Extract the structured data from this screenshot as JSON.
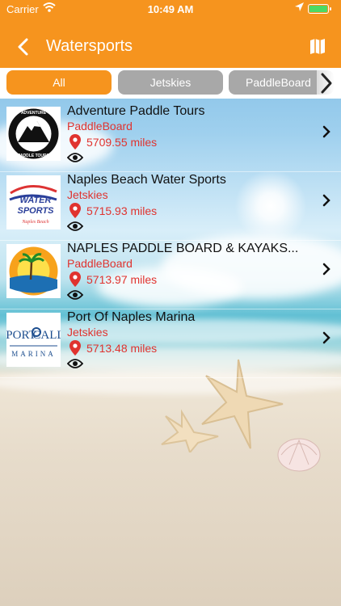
{
  "status_bar": {
    "carrier": "Carrier",
    "time": "10:49 AM"
  },
  "header": {
    "title": "Watersports"
  },
  "filters": [
    {
      "label": "All",
      "selected": true
    },
    {
      "label": "Jetskies",
      "selected": false
    },
    {
      "label": "PaddleBoard",
      "selected": false
    }
  ],
  "colors": {
    "accent": "#f6941e",
    "chip_inactive": "#a8a8a8",
    "category": "#e0332f"
  },
  "icons": {
    "back": "chevron-left-icon",
    "map": "map-icon",
    "next": "chevron-right-icon",
    "location": "location-pin-icon",
    "views": "eye-icon"
  },
  "listings": [
    {
      "name": "Adventure Paddle Tours",
      "category": "PaddleBoard",
      "distance": "5709.55 miles",
      "logo_text": [
        "ADVENTURE",
        "PADDLE TOURS"
      ]
    },
    {
      "name": "Naples Beach Water Sports",
      "category": "Jetskies",
      "distance": "5715.93 miles",
      "logo_text": [
        "WATER",
        "SPORTS",
        "Naples Beach"
      ]
    },
    {
      "name": "NAPLES PADDLE BOARD & KAYAKS...",
      "category": "PaddleBoard",
      "distance": "5713.97 miles",
      "logo_text": []
    },
    {
      "name": "Port Of Naples Marina",
      "category": "Jetskies",
      "distance": "5713.48 miles",
      "logo_text": [
        "PORT",
        "CALL",
        "MARINA"
      ]
    }
  ]
}
